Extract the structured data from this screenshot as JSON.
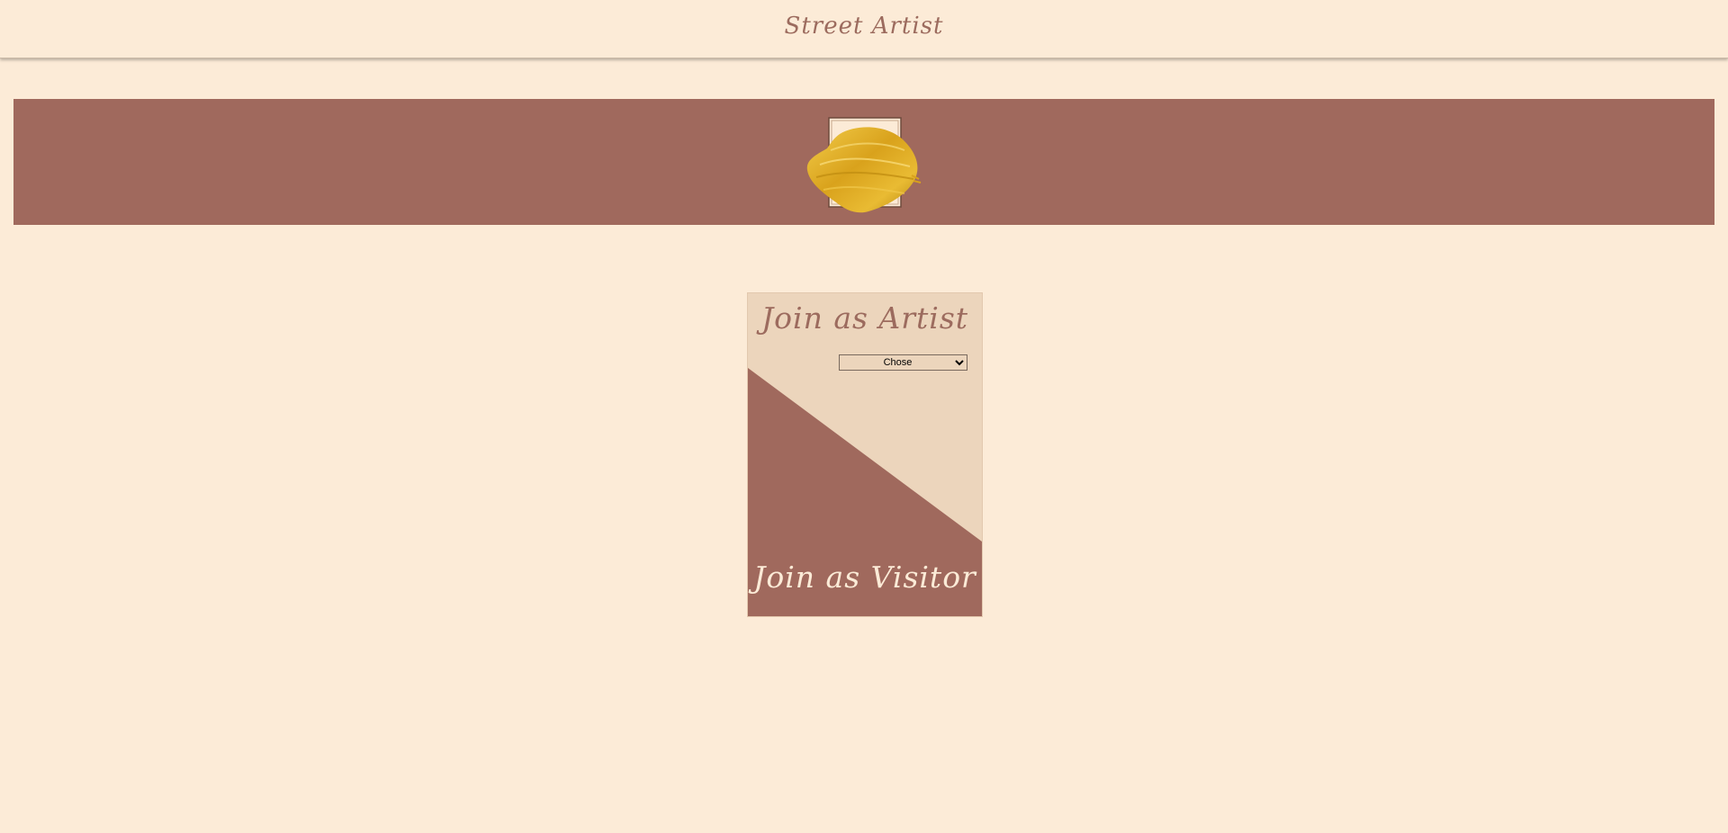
{
  "header": {
    "brand": "Street Artist"
  },
  "banner": {
    "logo_icon": "paint-stroke-frame-icon"
  },
  "join_card": {
    "artist_label": "Join as Artist",
    "role_select": {
      "selected": "Chose",
      "options": [
        "Chose"
      ]
    },
    "visitor_label": "Join as Visitor"
  },
  "colors": {
    "background": "#fcebd7",
    "accent": "#a0695d",
    "card_light": "#ecd5bc",
    "gold": "#d9a21c"
  }
}
